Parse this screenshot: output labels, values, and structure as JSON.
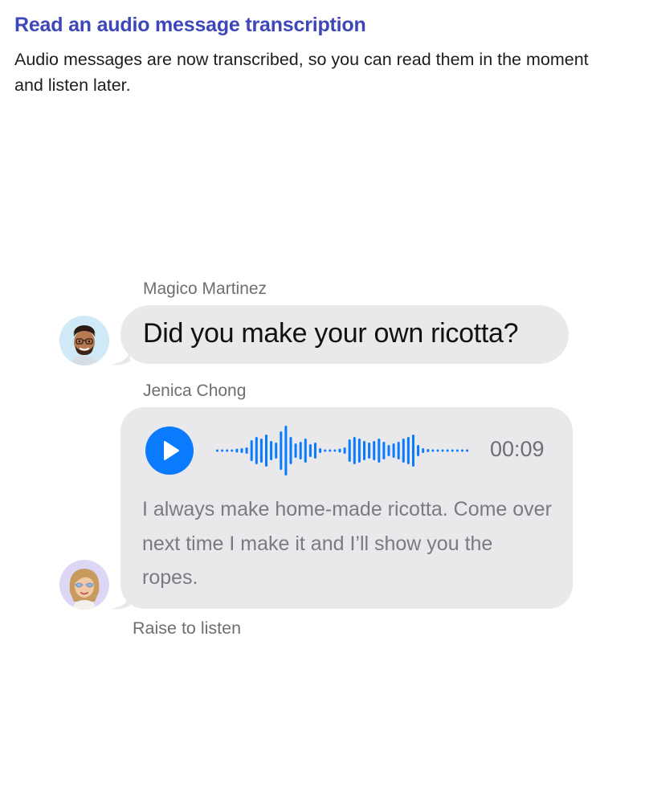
{
  "page": {
    "heading": "Read an audio message transcription",
    "description": "Audio messages are now transcribed, so you can read them in the moment and listen later."
  },
  "colors": {
    "heading": "#3d47b8",
    "bubble_background": "#e9e9eb",
    "accent_blue": "#0a7aff",
    "secondary_text": "#6e6e73"
  },
  "conversation": {
    "messages": [
      {
        "sender": "Magico Martinez",
        "avatar_icon": "memoji-man-avatar-icon",
        "type": "text",
        "text": "Did you make your own ricotta?"
      },
      {
        "sender": "Jenica Chong",
        "avatar_icon": "memoji-woman-avatar-icon",
        "type": "audio",
        "play_icon": "play-icon",
        "duration": "00:09",
        "transcription": "I always make home-made ricotta. Come over next time I make it and I’ll show you the ropes."
      }
    ],
    "footer_hint": "Raise to listen"
  }
}
